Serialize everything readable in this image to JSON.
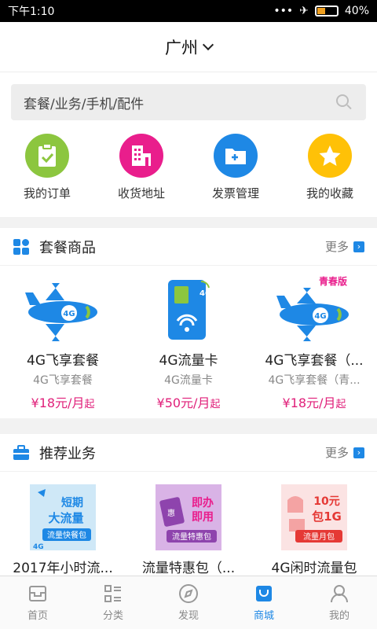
{
  "status": {
    "time": "下午1:10",
    "battery": "40%",
    "battery_level": 0.4
  },
  "header": {
    "city": "广州"
  },
  "search": {
    "placeholder": "套餐/业务/手机/配件"
  },
  "quick": [
    {
      "label": "我的订单",
      "icon": "clipboard-check-icon",
      "color": "#8cc63f"
    },
    {
      "label": "收货地址",
      "icon": "building-icon",
      "color": "#e91e8c"
    },
    {
      "label": "发票管理",
      "icon": "folder-add-icon",
      "color": "#1e88e5"
    },
    {
      "label": "我的收藏",
      "icon": "star-icon",
      "color": "#ffc107"
    }
  ],
  "packages": {
    "title": "套餐商品",
    "more": "更多",
    "items": [
      {
        "name": "4G飞享套餐",
        "sub": "4G飞享套餐",
        "price": "¥18元/月",
        "suffix": "起"
      },
      {
        "name": "4G流量卡",
        "sub": "4G流量卡",
        "price": "¥50元/月",
        "suffix": "起"
      },
      {
        "name": "4G飞享套餐（...",
        "sub": "4G飞享套餐（青...",
        "price": "¥18元/月",
        "suffix": "起",
        "badge": "青春版"
      }
    ]
  },
  "recommend": {
    "title": "推荐业务",
    "more": "更多",
    "items": [
      {
        "name": "2017年小时流...",
        "line1": "短期",
        "line2": "大流量",
        "tag": "流量快餐包"
      },
      {
        "name": "流量特惠包（...",
        "line1": "即办",
        "line2": "即用",
        "tag": "流量特惠包"
      },
      {
        "name": "4G闲时流量包",
        "line1": "10元",
        "line2": "包1G",
        "tag": "流量月包"
      }
    ]
  },
  "nav": [
    {
      "label": "首页",
      "icon": "home-icon",
      "active": false
    },
    {
      "label": "分类",
      "icon": "category-icon",
      "active": false
    },
    {
      "label": "发现",
      "icon": "compass-icon",
      "active": false
    },
    {
      "label": "商城",
      "icon": "shopping-bag-icon",
      "active": true
    },
    {
      "label": "我的",
      "icon": "user-icon",
      "active": false
    }
  ]
}
